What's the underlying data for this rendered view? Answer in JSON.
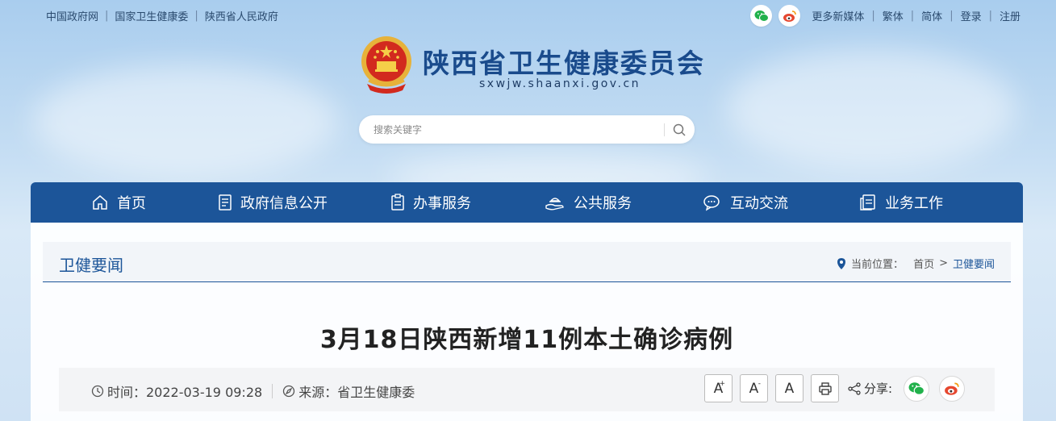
{
  "topbar": {
    "links": [
      "中国政府网",
      "国家卫生健康委",
      "陕西省人民政府"
    ],
    "more_media": "更多新媒体",
    "traditional": "繁体",
    "simplified": "简体",
    "login": "登录",
    "register": "注册"
  },
  "header": {
    "title": "陕西省卫生健康委员会",
    "domain": "sxwjw.shaanxi.gov.cn"
  },
  "search": {
    "placeholder": "搜索关键字"
  },
  "nav": {
    "items": [
      {
        "label": "首页",
        "icon": "home-icon"
      },
      {
        "label": "政府信息公开",
        "icon": "document-icon"
      },
      {
        "label": "办事服务",
        "icon": "clipboard-icon"
      },
      {
        "label": "公共服务",
        "icon": "hand-service-icon"
      },
      {
        "label": "互动交流",
        "icon": "chat-icon"
      },
      {
        "label": "业务工作",
        "icon": "files-icon"
      }
    ]
  },
  "section": {
    "title": "卫健要闻",
    "location_label": "当前位置：",
    "crumb_home": "首页",
    "crumb_sep": ">",
    "crumb_current": "卫健要闻"
  },
  "article": {
    "title": "3月18日陕西新增11例本土确诊病例",
    "time_label": "时间：2022-03-19 09:28",
    "source_label": "来源：省卫生健康委",
    "font_large": "A",
    "font_medium": "A",
    "font_default": "A",
    "share_label": "分享:"
  },
  "colors": {
    "nav_bg": "#1c5599",
    "title_blue": "#1a4b8c"
  }
}
